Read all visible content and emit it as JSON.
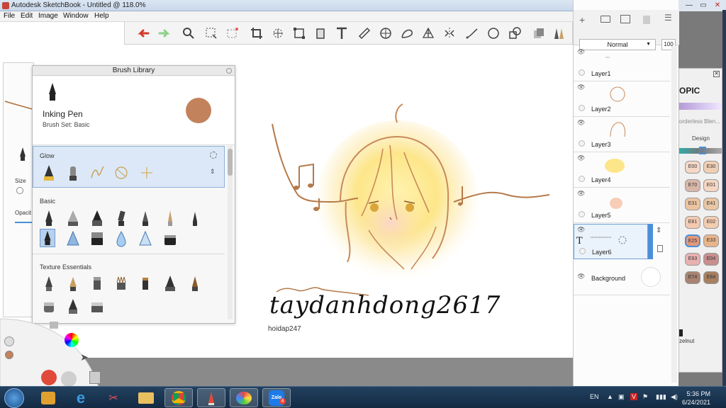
{
  "window": {
    "title": "Autodesk SketchBook - Untitled @ 118.0%",
    "minimize": "—",
    "maximize": "▭",
    "close": "✕"
  },
  "menu": [
    "File",
    "Edit",
    "Image",
    "Window",
    "Help"
  ],
  "toolbar": {
    "tools": [
      "undo-icon",
      "redo-icon",
      "zoom-icon",
      "select-icon",
      "lasso-select-icon",
      "crop-icon",
      "transform-icon",
      "distort-icon",
      "fill-icon",
      "text-icon",
      "ruler-icon",
      "ellipse-guide-icon",
      "french-curve-icon",
      "perspective-icon",
      "symmetry-icon",
      "stroke-icon",
      "circle-icon",
      "shapes-icon",
      "copic-library-icon",
      "brush-palette-icon"
    ]
  },
  "left_panel": {
    "size_label": "Size",
    "opacity_label": "Opacit"
  },
  "brush_library": {
    "title": "Brush Library",
    "brush_name": "Inking Pen",
    "brush_set": "Brush Set: Basic",
    "color": "#c2825c",
    "sections": [
      "Glow",
      "Basic",
      "Texture Essentials"
    ]
  },
  "canvas": {
    "signature": "taydanhdong2617",
    "watermark": "hoidap247"
  },
  "layers": {
    "blend_mode": "Normal",
    "opacity": "100",
    "items": [
      {
        "name": "Layer1"
      },
      {
        "name": "Layer2"
      },
      {
        "name": "Layer3"
      },
      {
        "name": "Layer4"
      },
      {
        "name": "Layer5"
      },
      {
        "name": "Layer6"
      },
      {
        "name": "Background"
      }
    ]
  },
  "copic": {
    "logo": "OPIC",
    "preset": "orderless Blen...",
    "design_tab": "Design",
    "chips": [
      "E00",
      "E30",
      "E70",
      "E01",
      "E31",
      "E41",
      "E81",
      "E02",
      "E25",
      "E33",
      "E93",
      "E04",
      "E74",
      "E84"
    ],
    "footer": "zelnut"
  },
  "taskbar": {
    "language": "EN",
    "time": "5:36 PM",
    "date": "6/24/2021",
    "zalo_badge": "4"
  }
}
